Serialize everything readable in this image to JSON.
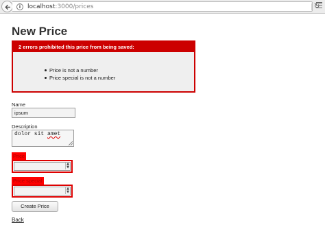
{
  "browser": {
    "url_host": "localhost",
    "url_path": ":3000/prices"
  },
  "page": {
    "title": "New Price"
  },
  "errors": {
    "header": "2 errors prohibited this price from being saved:",
    "items": [
      "Price is not a number",
      "Price special is not a number"
    ]
  },
  "form": {
    "name_label": "Name",
    "name_value": "ipsum",
    "description_label": "Description",
    "description_value_prefix": "dolor sit ",
    "description_value_misspelled": "amet",
    "price_label": "Price",
    "price_value": "",
    "price_special_label": "Price special",
    "price_special_value": "",
    "submit_label": "Create Price"
  },
  "links": {
    "back": "Back"
  },
  "colors": {
    "error_red": "#cc0000",
    "error_bg": "#efefef"
  }
}
